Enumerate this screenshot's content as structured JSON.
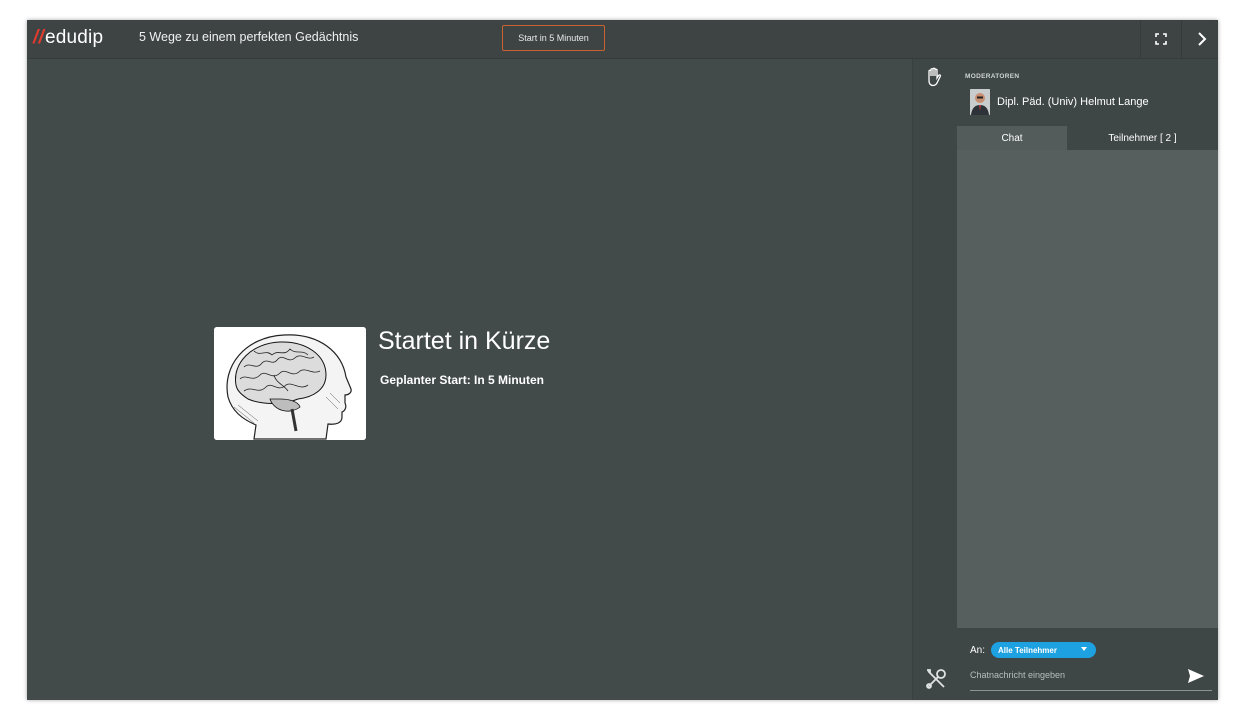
{
  "app": {
    "logo_mark": "//",
    "logo_text": "edudip",
    "event_title": "5 Wege zu einem perfekten Gedächtnis",
    "start_badge": "Start in 5 Minuten",
    "brand_color": "#e23b2e",
    "accent_color": "#1ea1e0"
  },
  "toolbar": {
    "fullscreen_icon": "fullscreen-icon",
    "collapse_icon": "chevron-right-icon"
  },
  "stage": {
    "title": "Startet in Kürze",
    "subtitle": "Geplanter Start: In 5 Minuten",
    "image_icon": "brain-head-illustration"
  },
  "tools": {
    "raise_hand_icon": "hand-icon",
    "tools_icon": "tools-icon"
  },
  "sidebar": {
    "moderators_heading": "MODERATOREN",
    "moderator_name": "Dipl. Päd. (Univ) Helmut Lange",
    "tabs": [
      {
        "label": "Chat",
        "active": true
      },
      {
        "label": "Teilnehmer [ 2 ]",
        "active": false
      }
    ],
    "chat": {
      "to_label": "An:",
      "recipient": "Alle Teilnehmer",
      "input_placeholder": "Chatnachricht eingeben",
      "send_icon": "send-icon"
    }
  }
}
